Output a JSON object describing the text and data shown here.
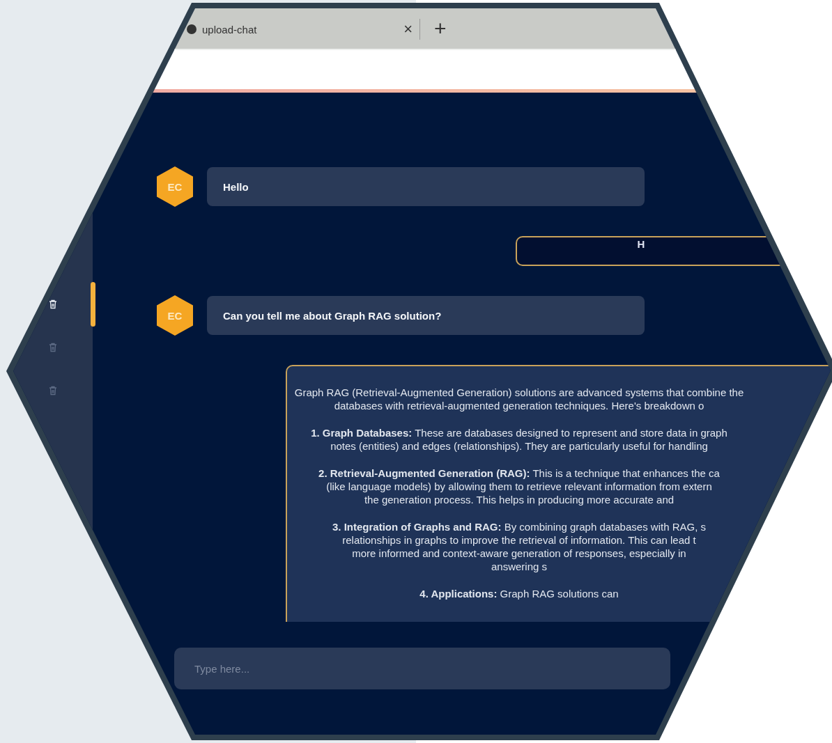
{
  "browser": {
    "tab": {
      "title": "upload-chat",
      "close": "×"
    },
    "new_tab": "+"
  },
  "sidebar": {
    "items": [
      {
        "selected": true
      },
      {
        "selected": false
      },
      {
        "selected": false
      }
    ]
  },
  "messages": [
    {
      "kind": "user",
      "avatar": "EC",
      "text": "Hello"
    },
    {
      "kind": "assistant",
      "paragraphs": [
        [
          "H"
        ]
      ]
    },
    {
      "kind": "user",
      "avatar": "EC",
      "text": "Can you tell me about Graph RAG solution?"
    },
    {
      "kind": "assistant",
      "paragraphs": [
        [
          "Graph RAG (Retrieval-Augmented Generation) solutions are advanced systems that combine the",
          "databases with retrieval-augmented generation techniques. Here's breakdown o"
        ],
        [
          "**1. Graph Databases:** These are databases designed to represent and store data in graph",
          "notes (entities) and edges (relationships). They are particularly useful for handling"
        ],
        [
          "**2. Retrieval-Augmented Generation (RAG):** This is a technique that enhances the ca",
          "(like language models) by allowing them to retrieve relevant information from extern",
          "the generation process. This helps in producing more accurate and"
        ],
        [
          "**3. Integration of Graphs and RAG:** By combining graph databases with RAG, s",
          "relationships in graphs to improve the retrieval of information. This can lead t",
          "more informed and context-aware generation of responses, especially in",
          "answering s"
        ],
        [
          "**4. Applications:** Graph RAG solutions can"
        ]
      ]
    }
  ],
  "composer": {
    "placeholder": "Type here..."
  }
}
